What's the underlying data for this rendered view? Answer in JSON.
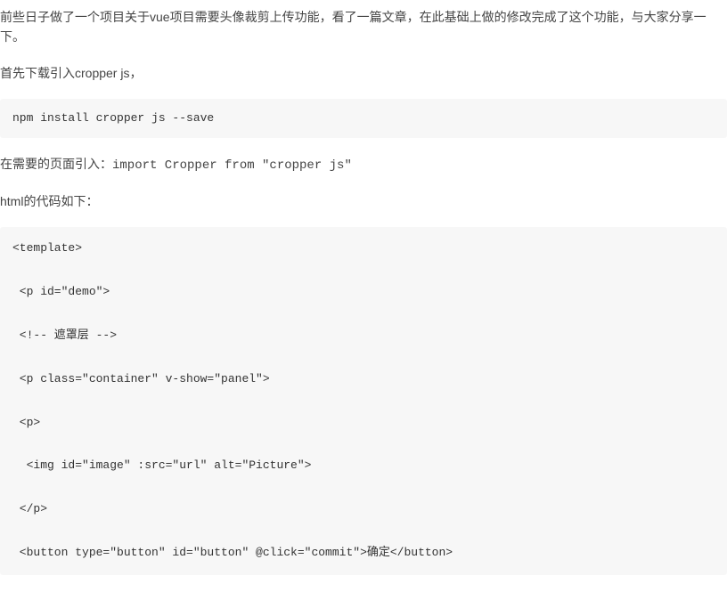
{
  "paragraphs": {
    "intro": "前些日子做了一个项目关于vue项目需要头像裁剪上传功能，看了一篇文章，在此基础上做的修改完成了这个功能，与大家分享一下。",
    "download": "首先下载引入cropper js，",
    "import_prefix": "在需要的页面引入：",
    "import_code": "import Cropper from \"cropper js\"",
    "html_label": "html的代码如下："
  },
  "code_npm": " npm install cropper js --save",
  "code_html": {
    "l1": "<template>",
    "l2": " <p id=\"demo\">",
    "l3": " <!-- 遮罩层 -->",
    "l4": " <p class=\"container\" v-show=\"panel\">",
    "l5": " <p>",
    "l6": "  <img id=\"image\" :src=\"url\" alt=\"Picture\">",
    "l7": " </p>",
    "l8": " <button type=\"button\" id=\"button\" @click=\"commit\">确定</button>"
  }
}
